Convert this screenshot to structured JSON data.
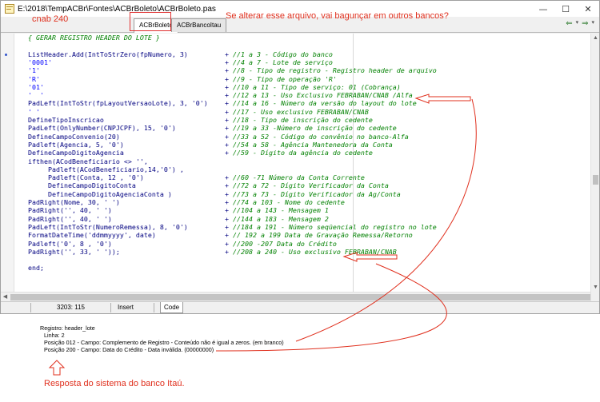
{
  "window": {
    "title": "E:\\2018\\TempACBr\\Fontes\\ACBrBoleto\\ACBrBoleto.pas",
    "controls": {
      "minimize": "—",
      "maximize": "☐",
      "close": "✕"
    }
  },
  "tabs": [
    {
      "label": "ACBrBoleto",
      "active": true
    },
    {
      "label": "ACBrBancoItau",
      "active": false
    }
  ],
  "nav": {
    "back": "⇐",
    "forward": "⇒"
  },
  "code": [
    {
      "text": "{ GERAR REGISTRO HEADER DO LOTE }",
      "kind": "comment"
    },
    {
      "text": "",
      "kind": "blank"
    },
    {
      "text": "ListHeader.Add(IntToStrZero(fpNumero, 3)",
      "comment": "//1 a 3 - Código do banco"
    },
    {
      "text": "'0001'",
      "comment": "//4 a 7 - Lote de serviço",
      "kind": "string"
    },
    {
      "text": "'1'",
      "comment": "//8 - Tipo de registro - Registro header de arquivo",
      "kind": "string"
    },
    {
      "text": "'R'",
      "comment": "//9 - Tipo de operação 'R'",
      "kind": "string"
    },
    {
      "text": "'01'",
      "comment": "//10 a 11 - Tipo de serviço: 01 (Cobrança)",
      "kind": "string"
    },
    {
      "text": "'  '",
      "comment": "//12 a 13 - Uso Exclusivo FEBRABAN/CNAB /Alfa",
      "kind": "string"
    },
    {
      "text": "PadLeft(IntToStr(fpLayoutVersaoLote), 3, '0')",
      "comment": "//14 a 16 - Número da versão do layout do lote"
    },
    {
      "text": "' '",
      "comment": "//17 - Uso exclusivo FEBRABAN/CNAB",
      "kind": "string"
    },
    {
      "text": "DefineTipoInscricao",
      "comment": "//18 - Tipo de inscrição do cedente"
    },
    {
      "text": "PadLeft(OnlyNumber(CNPJCPF), 15, '0')",
      "comment": "//19 a 33 -Número de inscrição do cedente"
    },
    {
      "text": "DefineCampoConvenio(20)",
      "comment": "//33 a 52 - Código do convênio no banco-Alfa"
    },
    {
      "text": "Padleft(Agencia, 5, '0')",
      "comment": "//54 a 58 - Agência Mantenedora da Conta"
    },
    {
      "text": "DefineCampoDigitoAgencia",
      "comment": "//59 - Dígito da agência do cedente"
    },
    {
      "text": "ifthen(ACodBeneficiario <> '',",
      "kind": "plain"
    },
    {
      "text": "     Padleft(ACodBeneficiario,14,'0') ,",
      "kind": "plain"
    },
    {
      "text": "     Padleft(Conta, 12 , '0')",
      "comment": "//60 -71 Número da Conta Corrente"
    },
    {
      "text": "     DefineCampoDigitoConta",
      "comment": "//72 a 72 - Dígito Verificador da Conta"
    },
    {
      "text": "     DefineCampoDigitoAgenciaConta )",
      "comment": "//73 a 73 - Dígito Verificador da Ag/Conta"
    },
    {
      "text": "PadRight(Nome, 30, ' ')",
      "comment": "//74 a 103 - Nome do cedente"
    },
    {
      "text": "PadRight('', 40, ' ')",
      "comment": "//104 a 143 - Mensagem 1"
    },
    {
      "text": "PadRight('', 40, ' ')",
      "comment": "//144 a 183 - Mensagem 2"
    },
    {
      "text": "PadLeft(IntToStr(NumeroRemessa), 8, '0')",
      "comment": "//184 a 191 - Número seqüencial do registro no lote"
    },
    {
      "text": "FormatDateTime('ddmmyyyy', date)",
      "comment": "// 192 a 199 Data de Gravação Remessa/Retorno"
    },
    {
      "text": "Padleft('0', 8 , '0')",
      "comment": "//200 -207 Data do Crédito"
    },
    {
      "text": "PadRight('', 33, ' '));",
      "comment": "//208 a 240 - Uso exclusivo FEBRABAN/CNAB"
    },
    {
      "text": "",
      "kind": "blank"
    },
    {
      "text": "end;",
      "kind": "plain"
    }
  ],
  "status": {
    "position": "3203: 115",
    "mode": "Insert",
    "view_tab": "Code"
  },
  "annotations": {
    "cnab": "cnab 240",
    "warning": "Se alterar esse arquivo, vai bagunçar em outros bancos?",
    "response_caption": "Resposta do sistema do banco Itaú."
  },
  "response": {
    "lines": [
      "Registro: header_lote",
      "Linha: 2",
      "Posição 012 - Campo: Complemento de Registro - Conteúdo não é igual a zeros. (em branco)",
      "Posição 200 - Campo: Data do Crédito - Data inválida. (00000000)"
    ]
  },
  "colors": {
    "annotation_red": "#e0301e",
    "code_keyword": "#000080",
    "code_comment": "#008000",
    "code_string": "#0000ff"
  }
}
